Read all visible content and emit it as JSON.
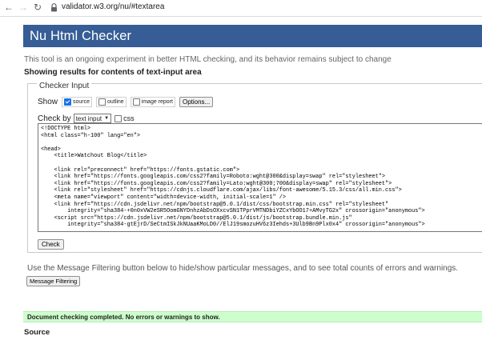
{
  "browser": {
    "url": "validator.w3.org/nu/#textarea",
    "icons": [
      "back-arrow-icon",
      "forward-arrow-icon",
      "reload-icon",
      "lock-icon"
    ]
  },
  "header": {
    "title": "Nu Html Checker",
    "bg_color": "#365d95"
  },
  "intro_text": "This tool is an ongoing experiment in better HTML checking, and its behavior remains subject to change",
  "results_heading": "Showing results for contents of text-input area",
  "checker": {
    "legend": "Checker Input",
    "show_label": "Show",
    "options": [
      {
        "label": "source",
        "checked": true
      },
      {
        "label": "outline",
        "checked": false
      },
      {
        "label": "image report",
        "checked": false
      }
    ],
    "options_button": "Options...",
    "check_by_label": "Check by",
    "check_by_value": "text input",
    "css_label": "css",
    "css_checked": false,
    "textarea_lines": [
      "<!DOCTYPE html>",
      "<html class=\"h-100\" lang=\"en\">",
      "",
      "<head>",
      "    <title>Watchout Blog</title>",
      "",
      "    <link rel=\"preconnect\" href=\"https://fonts.gstatic.com\">",
      "    <link href=\"https://fonts.googleapis.com/css2?family=Roboto:wght@300&display=swap\" rel=\"stylesheet\">",
      "    <link href=\"https://fonts.googleapis.com/css2?family=Lato:wght@300;700&display=swap\" rel=\"stylesheet\">",
      "    <link rel=\"stylesheet\" href=\"https://cdnjs.cloudflare.com/ajax/libs/font-awesome/5.15.3/css/all.min.css\">",
      "    <meta name=\"viewport\" content=\"width=device-width, initial-scale=1\" />",
      "    <link href=\"https://cdn.jsdelivr.net/npm/bootstrap@5.0.1/dist/css/bootstrap.min.css\" rel=\"stylesheet\"",
      "        integrity=\"sha384-+0n0xVW2eSR5OomGNYDnhzAbDsOXxcvSN1TPprVMTNDbiYZCxYbOO17+AMvyTG2x\" crossorigin=\"anonymous\">",
      "    <script src=\"https://cdn.jsdelivr.net/npm/bootstrap@5.0.1/dist/js/bootstrap.bundle.min.js\"",
      "        integrity=\"sha384-gtEjrD/SeCtmISkJkNUaaKMoLD0//ElJ19smozuHV6z3Iehds+3Ulb9Bn9Plx0x4\" crossorigin=\"anonymous\">"
    ],
    "check_button": "Check"
  },
  "filter_info": "Use the Message Filtering button below to hide/show particular messages, and to see total counts of errors and warnings.",
  "filter_button": "Message Filtering",
  "success_message": "Document checking completed. No errors or warnings to show.",
  "success_color": "#ccffcc",
  "source_heading": "Source"
}
